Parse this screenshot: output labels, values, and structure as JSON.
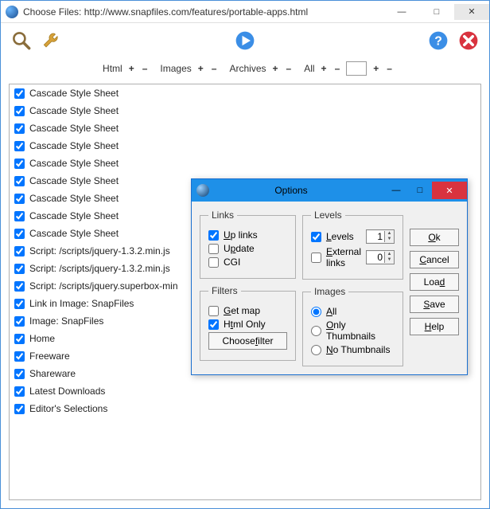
{
  "window": {
    "title": "Choose Files: http://www.snapfiles.com/features/portable-apps.html"
  },
  "filterbar": {
    "html": "Html",
    "images": "Images",
    "archives": "Archives",
    "all": "All"
  },
  "list": [
    "Cascade Style Sheet",
    "Cascade Style Sheet",
    "Cascade Style Sheet",
    "Cascade Style Sheet",
    "Cascade Style Sheet",
    "Cascade Style Sheet",
    "Cascade Style Sheet",
    "Cascade Style Sheet",
    "Cascade Style Sheet",
    "Script: /scripts/jquery-1.3.2.min.js",
    "Script: /scripts/jquery-1.3.2.min.js",
    "Script: /scripts/jquery.superbox-min",
    "Link in Image: SnapFiles",
    "Image: SnapFiles",
    "Home",
    "Freeware",
    "Shareware",
    "Latest Downloads",
    "Editor's Selections"
  ],
  "dialog": {
    "title": "Options",
    "groups": {
      "links": {
        "legend": "Links",
        "uplinks": "Up links",
        "update": "Update",
        "cgi": "CGI"
      },
      "levels": {
        "legend": "Levels",
        "levels_label": "Levels",
        "levels_value": "1",
        "external_label": "External links",
        "external_value": "0"
      },
      "filters": {
        "legend": "Filters",
        "getmap": "Get map",
        "htmlonly": "Html Only",
        "choose": "Choose filter"
      },
      "images": {
        "legend": "Images",
        "all": "All",
        "onlythumbs": "Only Thumbnails",
        "nothumbs": "No Thumbnails"
      }
    },
    "buttons": {
      "ok": "Ok",
      "cancel": "Cancel",
      "load": "Load",
      "save": "Save",
      "help": "Help"
    }
  }
}
